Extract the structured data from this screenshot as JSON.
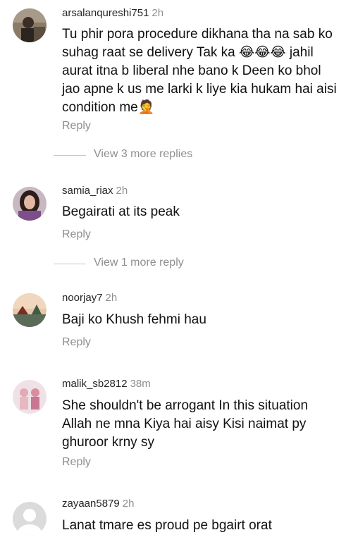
{
  "comments": [
    {
      "username": "arsalanqureshi751",
      "time": "2h",
      "text": "Tu phir pora procedure dikhana tha na sab ko suhag raat se delivery Tak ka 😂😂😂 jahil aurat itna b liberal nhe bano k Deen ko bhol jao apne k us me larki k liye kia hukam hai aisi condition me🤦",
      "reply_label": "Reply",
      "view_more": "View 3 more replies"
    },
    {
      "username": "samia_riax",
      "time": "2h",
      "text": "Begairati at its peak",
      "reply_label": "Reply",
      "view_more": "View 1 more reply"
    },
    {
      "username": "noorjay7",
      "time": "2h",
      "text": "Baji ko Khush fehmi hau",
      "reply_label": "Reply"
    },
    {
      "username": "malik_sb2812",
      "time": "38m",
      "text": "She shouldn't be arrogant In this situation Allah ne mna Kiya hai aisy Kisi naimat py ghuroor krny sy",
      "reply_label": "Reply"
    },
    {
      "username": "zayaan5879",
      "time": "2h",
      "text": "Lanat tmare es proud pe bgairt orat"
    }
  ]
}
